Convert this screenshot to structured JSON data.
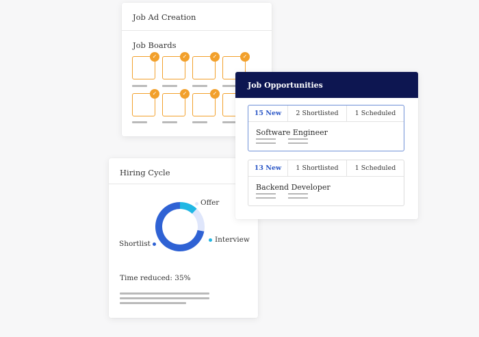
{
  "job_ad": {
    "title": "Job Ad Creation",
    "subtitle": "Job Boards",
    "boards_checked": 8
  },
  "opportunities": {
    "title": "Job Opportunities",
    "items": [
      {
        "new": "15 New",
        "shortlisted": "2 Shortlisted",
        "scheduled": "1 Scheduled",
        "role": "Software Engineer"
      },
      {
        "new": "13 New",
        "shortlisted": "1 Shortlisted",
        "scheduled": "1 Scheduled",
        "role": "Backend Developer"
      }
    ]
  },
  "hiring": {
    "title": "Hiring Cycle",
    "labels": {
      "offer": "Offer",
      "interview": "Interview",
      "shortlist": "Shortlist"
    },
    "reduced_text": "Time reduced: 35%",
    "chart_data": {
      "type": "pie",
      "categories": [
        "Shortlist",
        "Interview",
        "Offer"
      ],
      "values": [
        72,
        12,
        16
      ],
      "colors": [
        "#2f62d4",
        "#20b7e4",
        "#dfe6fb"
      ]
    }
  },
  "colors": {
    "accent": "#f2a02b",
    "navy": "#0d1651",
    "link": "#2a56c6"
  }
}
